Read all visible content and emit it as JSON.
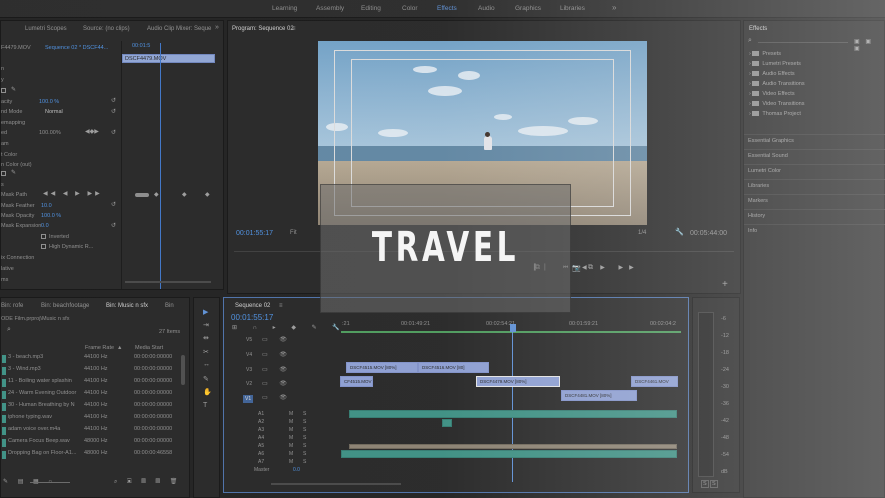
{
  "workspaces": [
    "Learning",
    "Assembly",
    "Editing",
    "Color",
    "Effects",
    "Audio",
    "Graphics",
    "Libraries"
  ],
  "workspaces_more": "»",
  "active_workspace": "Effects",
  "source_panel": {
    "tabs": [
      "Lumetri Scopes",
      "Source: (no clips)",
      "Audio Clip Mixer: Seque"
    ],
    "more": "»",
    "master_clip": "F4479.MOV",
    "sequence_clip": "Sequence 02 * DSCF44...",
    "timecode": "00:01:5",
    "clip_label": "DSCF4479.MOV",
    "rows": [
      {
        "label": "n",
        "value": ""
      },
      {
        "label": "y",
        "value": ""
      },
      {
        "label": "acity",
        "value": "100.0 %"
      },
      {
        "label": "nd Mode",
        "value": "Normal"
      },
      {
        "label": "emapping",
        "value": ""
      },
      {
        "label": "ed",
        "value": "100.00%"
      },
      {
        "label": "am",
        "value": ""
      },
      {
        "label": "t Color",
        "value": ""
      },
      {
        "label": "n Color (out)",
        "value": ""
      },
      {
        "label": "s",
        "value": ""
      },
      {
        "label": "Mask Path",
        "value": ""
      },
      {
        "label": "Mask Feather",
        "value": "10.0"
      },
      {
        "label": "Mask Opacity",
        "value": "100.0 %"
      },
      {
        "label": "Mask Expansion",
        "value": "0.0"
      },
      {
        "label": "Inverted",
        "value": ""
      },
      {
        "label": "High Dynamic R...",
        "value": ""
      },
      {
        "label": "ix Connection",
        "value": ""
      },
      {
        "label": "lative",
        "value": ""
      },
      {
        "label": "ms",
        "value": ""
      }
    ]
  },
  "program_monitor": {
    "title": "Program: Sequence 02",
    "timecode": "00:01:55:17",
    "fit": "Fit",
    "resolution": "1/4",
    "duration": "00:05:44:00",
    "add_button": "+"
  },
  "effects_panel": {
    "title": "Effects",
    "folders": [
      "Presets",
      "Lumetri Presets",
      "Audio Effects",
      "Audio Transitions",
      "Video Effects",
      "Video Transitions",
      "Thomas Project"
    ],
    "sections": [
      "Essential Graphics",
      "Essential Sound",
      "Lumetri Color",
      "Libraries",
      "Markers",
      "History",
      "Info"
    ]
  },
  "project_panel": {
    "tabs": [
      "Bin: rofe",
      "Bin: beachfootage",
      "Bin: Music n sfx",
      "Bin"
    ],
    "path": "ODE Film.prproj\\Music n sfx",
    "item_count": "27 Items",
    "columns": [
      "Frame Rate",
      "Media Start"
    ],
    "items": [
      {
        "name": "3 - beach.mp3",
        "rate": "44100 Hz",
        "start": "00:00:00:00000"
      },
      {
        "name": "3 - Wind.mp3",
        "rate": "44100 Hz",
        "start": "00:00:00:00000"
      },
      {
        "name": "11 - Boiling water splashin",
        "rate": "44100 Hz",
        "start": "00:00:00:00000"
      },
      {
        "name": "24 - Warm Evening Outdoor",
        "rate": "44100 Hz",
        "start": "00:00:00:00000"
      },
      {
        "name": "30 - Human Breathing by N",
        "rate": "44100 Hz",
        "start": "00:00:00:00000"
      },
      {
        "name": "iphone typing.wav",
        "rate": "44100 Hz",
        "start": "00:00:00:00000"
      },
      {
        "name": "adam voice over.m4a",
        "rate": "44100 Hz",
        "start": "00:00:00:00000"
      },
      {
        "name": "Camera Focus Beep.wav",
        "rate": "48000 Hz",
        "start": "00:00:00:00000"
      },
      {
        "name": "Dropping Bag on Floor-A1...",
        "rate": "48000 Hz",
        "start": "00:00:00:46558"
      }
    ]
  },
  "timeline": {
    "title": "Sequence 02",
    "timecode": "00:01:55:17",
    "ruler": [
      ":21",
      "00:01:49:21",
      "00:02:54:21",
      "00:01:59:21",
      "00:02:04:2"
    ],
    "video_tracks": [
      "V5",
      "V4",
      "V3",
      "V2",
      "V1"
    ],
    "audio_tracks": [
      "A1",
      "A2",
      "A3",
      "A4",
      "A5",
      "A6",
      "A7"
    ],
    "audio_track_buttons": [
      "M",
      "S"
    ],
    "master": "Master",
    "master_value": "0.0",
    "clips": [
      {
        "label": "DSCF4515.MOV [80%]",
        "track": "V3"
      },
      {
        "label": "DSCF4516.MOV [80]",
        "track": "V3"
      },
      {
        "label": "CF4515.MOV",
        "track": "V2"
      },
      {
        "label": "DSCF4479.MOV [80%]",
        "track": "V2"
      },
      {
        "label": "DSCF4461.MOV",
        "track": "V2"
      },
      {
        "label": "DSCF4481.MOV [80%]",
        "track": "V1"
      }
    ]
  },
  "meter_labels": [
    "-6",
    "-12",
    "-18",
    "-24",
    "-30",
    "-36",
    "-42",
    "-48",
    "-54",
    "dB"
  ],
  "meter_buttons": [
    "S",
    "S"
  ],
  "overlay_title": "TRAVEL"
}
